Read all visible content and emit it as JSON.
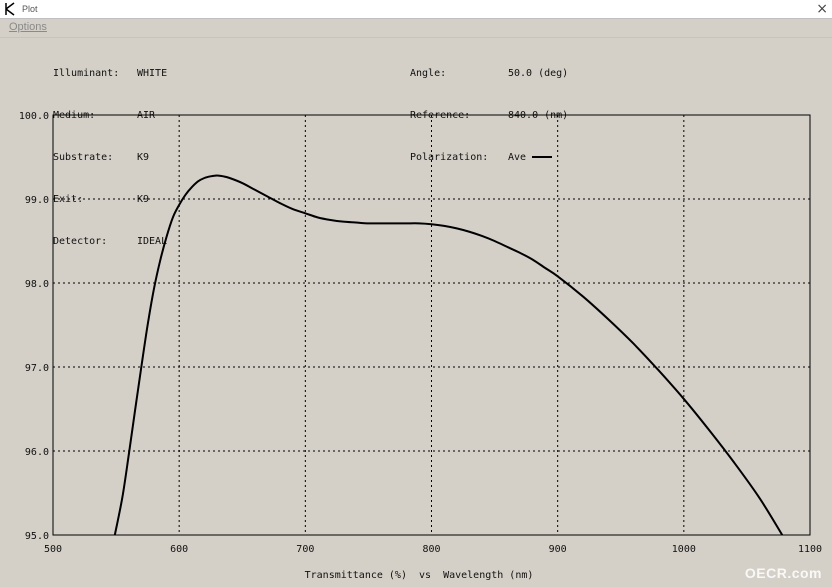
{
  "window": {
    "title": "Plot",
    "close_glyph": "×"
  },
  "menu": {
    "options": "Options"
  },
  "info_left": [
    {
      "label": "Illuminant:",
      "value": "WHITE"
    },
    {
      "label": "Medium:",
      "value": "AIR"
    },
    {
      "label": "Substrate:",
      "value": "K9"
    },
    {
      "label": "Exit:",
      "value": "K9"
    },
    {
      "label": "Detector:",
      "value": "IDEAL"
    }
  ],
  "info_right": [
    {
      "label": "Angle:",
      "value": "50.0 (deg)"
    },
    {
      "label": "Reference:",
      "value": "840.0 (nm)"
    },
    {
      "label": "Polarization:",
      "value": "Ave"
    }
  ],
  "watermark": "OECR.com",
  "chart_data": {
    "type": "line",
    "xlabel": "Transmittance (%)  vs  Wavelength (nm)",
    "ylabel": "",
    "xlim": [
      500,
      1100
    ],
    "ylim": [
      95.0,
      100.0
    ],
    "xticks": [
      "500",
      "600",
      "700",
      "800",
      "900",
      "1000",
      "1100"
    ],
    "yticks": [
      "95.0",
      "96.0",
      "97.0",
      "98.0",
      "99.0",
      "100.0"
    ],
    "grid": true,
    "grid_style": "dotted",
    "line_color": "#000000",
    "series": [
      {
        "name": "Ave",
        "x": [
          549,
          555,
          560,
          565,
          570,
          575,
          580,
          585,
          590,
          595,
          600,
          605,
          610,
          615,
          620,
          625,
          630,
          635,
          640,
          650,
          660,
          670,
          680,
          690,
          700,
          710,
          720,
          730,
          740,
          750,
          760,
          770,
          780,
          790,
          800,
          810,
          820,
          830,
          840,
          850,
          860,
          870,
          880,
          890,
          900,
          920,
          940,
          960,
          980,
          1000,
          1020,
          1040,
          1060,
          1078
        ],
        "y": [
          95.0,
          95.45,
          95.95,
          96.48,
          97.0,
          97.5,
          97.93,
          98.27,
          98.55,
          98.78,
          98.93,
          99.05,
          99.14,
          99.21,
          99.25,
          99.27,
          99.28,
          99.27,
          99.25,
          99.19,
          99.11,
          99.03,
          98.95,
          98.88,
          98.83,
          98.78,
          98.75,
          98.73,
          98.72,
          98.71,
          98.71,
          98.71,
          98.71,
          98.71,
          98.7,
          98.68,
          98.65,
          98.61,
          98.56,
          98.5,
          98.43,
          98.36,
          98.28,
          98.18,
          98.08,
          97.84,
          97.57,
          97.28,
          96.96,
          96.62,
          96.25,
          95.86,
          95.44,
          95.0
        ]
      }
    ]
  }
}
